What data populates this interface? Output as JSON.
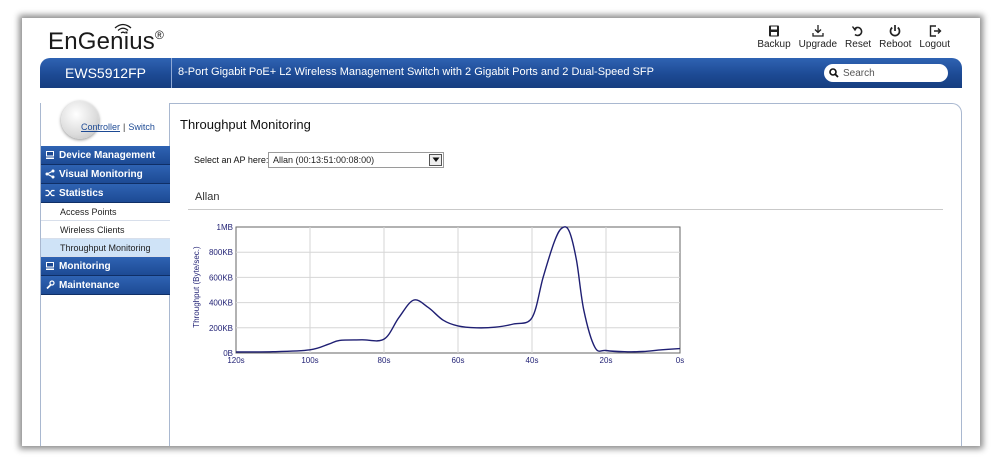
{
  "brand": {
    "name": "EnGenius",
    "reg_mark": "®"
  },
  "toolbar": [
    {
      "label": "Backup",
      "icon": "save-icon"
    },
    {
      "label": "Upgrade",
      "icon": "download-icon"
    },
    {
      "label": "Reset",
      "icon": "reset-icon"
    },
    {
      "label": "Reboot",
      "icon": "power-icon"
    },
    {
      "label": "Logout",
      "icon": "logout-icon"
    }
  ],
  "header": {
    "model": "EWS5912FP",
    "description": "8-Port Gigabit PoE+ L2 Wireless Management Switch with 2 Gigabit Ports and 2 Dual-Speed SFP",
    "search_placeholder": "Search"
  },
  "mode_links": {
    "controller": "Controller",
    "separator": "|",
    "switch": "Switch"
  },
  "sidebar": {
    "items": [
      {
        "label": "Device Management",
        "icon": "computer-icon",
        "type": "header"
      },
      {
        "label": "Visual Monitoring",
        "icon": "share-icon",
        "type": "header"
      },
      {
        "label": "Statistics",
        "icon": "shuffle-icon",
        "type": "header"
      },
      {
        "label": "Access Points",
        "type": "sub"
      },
      {
        "label": "Wireless Clients",
        "type": "sub"
      },
      {
        "label": "Throughput Monitoring",
        "type": "sub",
        "active": true
      },
      {
        "label": "Monitoring",
        "icon": "computer-icon",
        "type": "header"
      },
      {
        "label": "Maintenance",
        "icon": "wrench-icon",
        "type": "header"
      }
    ]
  },
  "main": {
    "title": "Throughput Monitoring",
    "select_label": "Select an AP here:",
    "selected_ap": "Allan (00:13:51:00:08:00)",
    "section_title": "Allan"
  },
  "colors": {
    "brand_blue": "#1d4a94",
    "line": "#1f1f73",
    "active_row": "#cfe3f7"
  },
  "chart_data": {
    "type": "line",
    "title": "",
    "xlabel": "",
    "ylabel": "Throughput (Byte/sec.)",
    "x_tick_labels": [
      "120s",
      "100s",
      "80s",
      "60s",
      "40s",
      "20s",
      "0s"
    ],
    "y_tick_labels": [
      "0B",
      "200KB",
      "400KB",
      "600KB",
      "800KB",
      "1MB"
    ],
    "xlim": [
      120,
      0
    ],
    "ylim": [
      0,
      1000
    ],
    "y_unit": "KB",
    "grid": true,
    "series": [
      {
        "name": "",
        "x": [
          120,
          110,
          100,
          95,
          92,
          86,
          80,
          76,
          72,
          68,
          64,
          60,
          55,
          50,
          45,
          40,
          37,
          34,
          32,
          30,
          28,
          26,
          23,
          20,
          15,
          10,
          5,
          0
        ],
        "y": [
          8,
          10,
          25,
          70,
          100,
          105,
          110,
          280,
          420,
          360,
          260,
          215,
          200,
          205,
          230,
          280,
          600,
          880,
          990,
          970,
          740,
          340,
          45,
          20,
          10,
          12,
          25,
          35
        ]
      }
    ]
  }
}
